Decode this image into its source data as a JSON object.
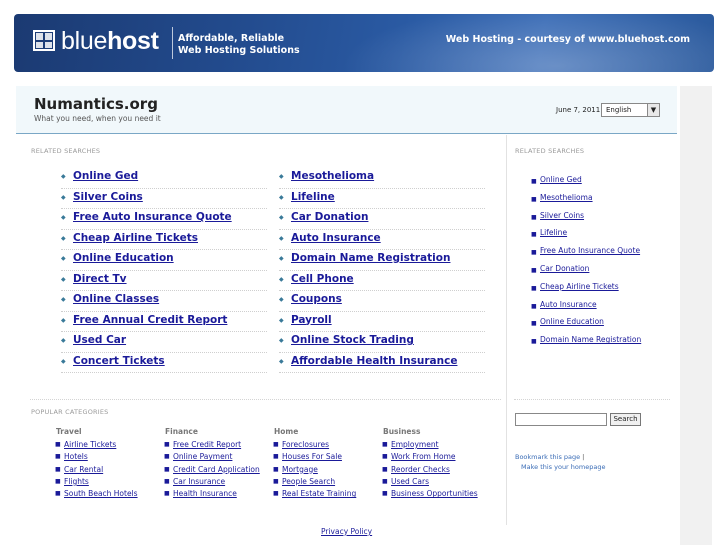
{
  "banner": {
    "logo_prefix": "blue",
    "logo_suffix": "host",
    "tagline_line1": "Affordable, Reliable",
    "tagline_line2": "Web Hosting Solutions",
    "courtesy": "Web Hosting - courtesy of www.bluehost.com"
  },
  "header": {
    "site_title": "Numantics.org",
    "site_subtitle": "What you need, when you need it",
    "date": "June 7, 2011",
    "language": "English",
    "language_arrow": "▼"
  },
  "related_searches": {
    "title": "RELATED SEARCHES",
    "bullet": "◆",
    "left": [
      "Online Ged",
      "Silver Coins",
      "Free Auto Insurance Quote",
      "Cheap Airline Tickets",
      "Online Education",
      "Direct Tv",
      "Online Classes",
      "Free Annual Credit Report",
      "Used Car",
      "Concert Tickets"
    ],
    "right": [
      "Mesothelioma",
      "Lifeline",
      "Car Donation",
      "Auto Insurance",
      "Domain Name Registration",
      "Cell Phone",
      "Coupons",
      "Payroll",
      "Online Stock Trading",
      "Affordable Health Insurance"
    ]
  },
  "sidebar": {
    "title": "RELATED SEARCHES",
    "dot": "■",
    "items": [
      "Online Ged",
      "Mesothelioma",
      "Silver Coins",
      "Lifeline",
      "Free Auto Insurance Quote",
      "Car Donation",
      "Cheap Airline Tickets",
      "Auto Insurance",
      "Online Education",
      "Domain Name Registration"
    ],
    "search_button": "Search",
    "bookmark": "Bookmark this page",
    "bookmark_separator": "|",
    "homepage": "Make this your homepage"
  },
  "popular": {
    "title": "POPULAR CATEGORIES",
    "dot": "■",
    "categories": [
      {
        "name": "Travel",
        "items": [
          "Airline Tickets",
          "Hotels",
          "Car Rental",
          "Flights",
          "South Beach Hotels"
        ]
      },
      {
        "name": "Finance",
        "items": [
          "Free Credit Report",
          "Online Payment",
          "Credit Card Application",
          "Car Insurance",
          "Health Insurance"
        ]
      },
      {
        "name": "Home",
        "items": [
          "Foreclosures",
          "Houses For Sale",
          "Mortgage",
          "People Search",
          "Real Estate Training"
        ]
      },
      {
        "name": "Business",
        "items": [
          "Employment",
          "Work From Home",
          "Reorder Checks",
          "Used Cars",
          "Business Opportunities"
        ]
      }
    ]
  },
  "footer": {
    "privacy": "Privacy Policy"
  },
  "colors": {
    "banner": "#224a8c",
    "header_bg": "#f1f8fb",
    "link": "#1a1a99",
    "bullet": "#3a7a99"
  }
}
